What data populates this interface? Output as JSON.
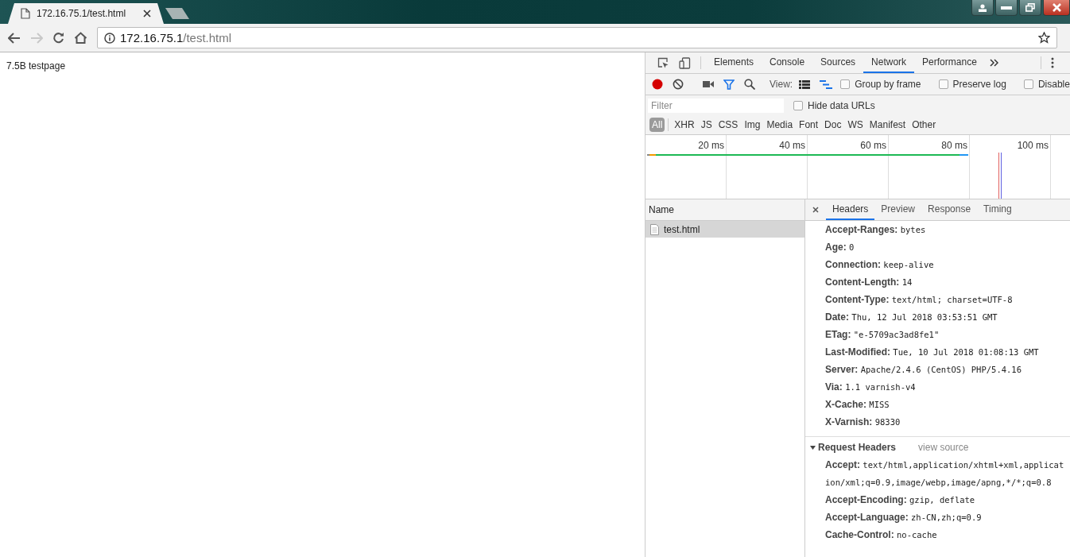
{
  "tab": {
    "title": "172.16.75.1/test.html"
  },
  "address": {
    "host": "172.16.75.1",
    "path": "/test.html"
  },
  "page": {
    "text": "7.5B testpage"
  },
  "devtools": {
    "panels": [
      {
        "label": "Elements",
        "selected": false
      },
      {
        "label": "Console",
        "selected": false
      },
      {
        "label": "Sources",
        "selected": false
      },
      {
        "label": "Network",
        "selected": true
      },
      {
        "label": "Performance",
        "selected": false
      }
    ],
    "toolbar": {
      "view_label": "View:",
      "options": [
        {
          "label": "Group by frame",
          "checked": false
        },
        {
          "label": "Preserve log",
          "checked": false
        },
        {
          "label": "Disable",
          "checked": false
        }
      ]
    },
    "filter": {
      "placeholder": "Filter",
      "hide_data_urls": {
        "label": "Hide data URLs",
        "checked": false
      }
    },
    "types": [
      {
        "label": "All",
        "selected": true
      },
      {
        "label": "XHR",
        "selected": false
      },
      {
        "label": "JS",
        "selected": false
      },
      {
        "label": "CSS",
        "selected": false
      },
      {
        "label": "Img",
        "selected": false
      },
      {
        "label": "Media",
        "selected": false
      },
      {
        "label": "Font",
        "selected": false
      },
      {
        "label": "Doc",
        "selected": false
      },
      {
        "label": "WS",
        "selected": false
      },
      {
        "label": "Manifest",
        "selected": false
      },
      {
        "label": "Other",
        "selected": false
      }
    ],
    "overview": {
      "ticks": [
        "20 ms",
        "40 ms",
        "60 ms",
        "80 ms",
        "100 ms"
      ]
    },
    "requests": {
      "column": "Name",
      "rows": [
        {
          "name": "test.html",
          "selected": true
        }
      ]
    },
    "detail_tabs": [
      {
        "label": "Headers",
        "selected": true
      },
      {
        "label": "Preview",
        "selected": false
      },
      {
        "label": "Response",
        "selected": false
      },
      {
        "label": "Timing",
        "selected": false
      }
    ],
    "response_headers": [
      {
        "name": "Accept-Ranges:",
        "value": "bytes"
      },
      {
        "name": "Age:",
        "value": "0"
      },
      {
        "name": "Connection:",
        "value": "keep-alive"
      },
      {
        "name": "Content-Length:",
        "value": "14"
      },
      {
        "name": "Content-Type:",
        "value": "text/html; charset=UTF-8"
      },
      {
        "name": "Date:",
        "value": "Thu, 12 Jul 2018 03:53:51 GMT"
      },
      {
        "name": "ETag:",
        "value": "\"e-5709ac3ad8fe1\""
      },
      {
        "name": "Last-Modified:",
        "value": "Tue, 10 Jul 2018 01:08:13 GMT"
      },
      {
        "name": "Server:",
        "value": "Apache/2.4.6 (CentOS) PHP/5.4.16"
      },
      {
        "name": "Via:",
        "value": "1.1 varnish-v4"
      },
      {
        "name": "X-Cache:",
        "value": "MISS"
      },
      {
        "name": "X-Varnish:",
        "value": "98330"
      }
    ],
    "request_headers": {
      "title": "Request Headers",
      "expanded": true,
      "link": "view source",
      "headers": [
        {
          "name": "Accept:",
          "value": "text/html,application/xhtml+xml,application/xml;q=0.9,image/webp,image/apng,*/*;q=0.8"
        },
        {
          "name": "Accept-Encoding:",
          "value": "gzip, deflate"
        },
        {
          "name": "Accept-Language:",
          "value": "zh-CN,zh;q=0.9"
        },
        {
          "name": "Cache-Control:",
          "value": "no-cache"
        }
      ]
    }
  }
}
